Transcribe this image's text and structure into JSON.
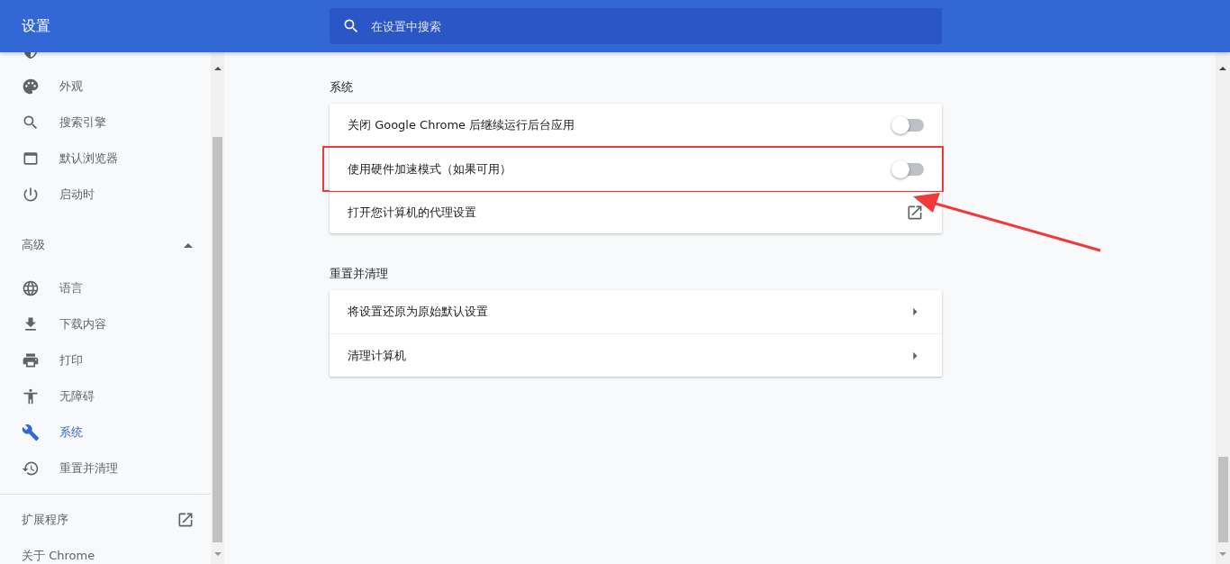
{
  "header": {
    "title": "设置",
    "search": {
      "placeholder": "在设置中搜索"
    }
  },
  "sidebar": {
    "items": [
      {
        "label": "外观",
        "selected": false
      },
      {
        "label": "搜索引擎",
        "selected": false
      },
      {
        "label": "默认浏览器",
        "selected": false
      },
      {
        "label": "启动时",
        "selected": false
      }
    ],
    "advanced": {
      "label": "高级",
      "expanded": true,
      "items": [
        {
          "label": "语言",
          "selected": false
        },
        {
          "label": "下载内容",
          "selected": false
        },
        {
          "label": "打印",
          "selected": false
        },
        {
          "label": "无障碍",
          "selected": false
        },
        {
          "label": "系统",
          "selected": true
        },
        {
          "label": "重置并清理",
          "selected": false
        }
      ]
    },
    "footer": [
      {
        "label": "扩展程序",
        "kind": "external"
      },
      {
        "label": "关于 Chrome",
        "kind": "plain"
      }
    ]
  },
  "sections": [
    {
      "title": "系统",
      "rows": [
        {
          "kind": "toggle",
          "label": "关闭 Google Chrome 后继续运行后台应用",
          "on": false,
          "highlighted": false
        },
        {
          "kind": "toggle",
          "label": "使用硬件加速模式（如果可用）",
          "on": false,
          "highlighted": true
        },
        {
          "kind": "external",
          "label": "打开您计算机的代理设置",
          "highlighted": false
        }
      ]
    },
    {
      "title": "重置并清理",
      "rows": [
        {
          "kind": "arrow",
          "label": "将设置还原为原始默认设置",
          "highlighted": false
        },
        {
          "kind": "arrow",
          "label": "清理计算机",
          "highlighted": false
        }
      ]
    }
  ]
}
